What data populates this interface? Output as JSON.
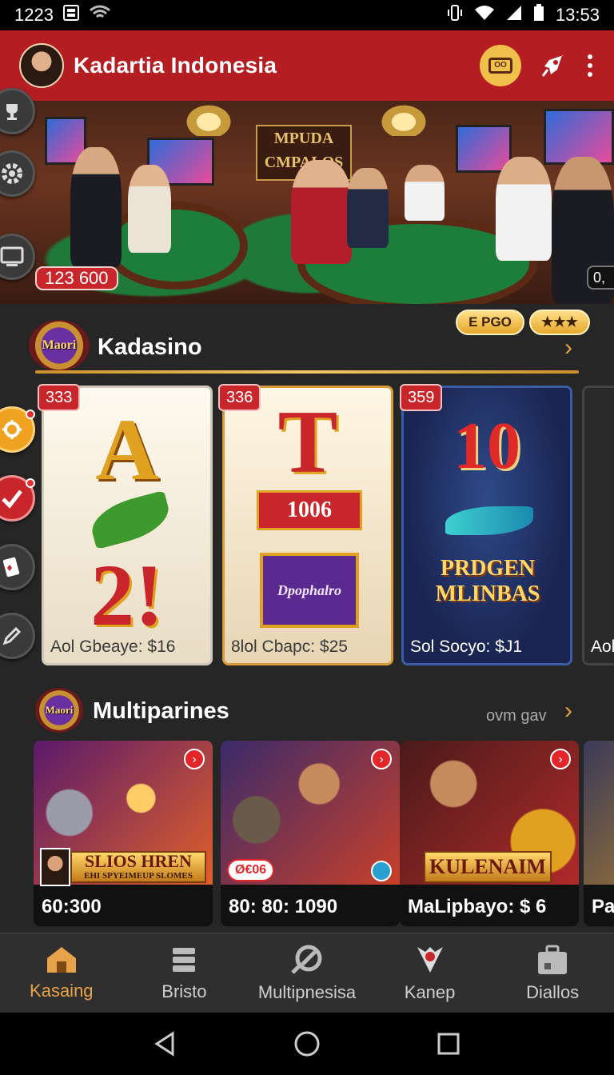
{
  "status_bar": {
    "left_time": "1223",
    "clock": "13:53"
  },
  "app_bar": {
    "title": "Kadartia Indonesia",
    "ticket_text": "OO"
  },
  "hero": {
    "sign_text": "MPUDA CMPALOS",
    "badge": "123 600",
    "badge_right": "0,"
  },
  "section1": {
    "logo_text": "Maori",
    "title": "Kadasino",
    "pill_1": "E PGO",
    "pill_2": "★★★"
  },
  "cards": [
    {
      "num": "333",
      "caption": "Aol Gbeaye: $16",
      "top": "A",
      "bottom": "2!"
    },
    {
      "num": "336",
      "caption": "8lol Cbapc: $25",
      "top": "T",
      "mid": "1006",
      "bottom": "Dpophalro"
    },
    {
      "num": "359",
      "caption": "Sol Socyo: $J1",
      "top": "10",
      "bottom": "PRDGEN MLINBAS"
    },
    {
      "caption": "Aol"
    }
  ],
  "section2": {
    "logo_text": "Maori",
    "title": "Multiparines",
    "link": "ovm gav"
  },
  "mcards": [
    {
      "banner": "SLIOS HREN",
      "banner_sub": "EHI SPYEIMEUP SLOMES",
      "caption": "60:300"
    },
    {
      "tag": "Ø€06",
      "caption": "80: 80: 1090"
    },
    {
      "banner": "KULENAIM",
      "caption": "MaLipbayo: $ 6"
    },
    {
      "caption": "Pa"
    }
  ],
  "bottom_nav": [
    {
      "label": "Kasaing",
      "icon": "home-icon"
    },
    {
      "label": "Bristo",
      "icon": "stack-icon"
    },
    {
      "label": "Multipnesisa",
      "icon": "chip-icon"
    },
    {
      "label": "Kanep",
      "icon": "badge-icon"
    },
    {
      "label": "Diallos",
      "icon": "briefcase-icon"
    }
  ],
  "colors": {
    "app_bar": "#b41e22",
    "accent": "#e8a24a",
    "background": "#262626"
  }
}
